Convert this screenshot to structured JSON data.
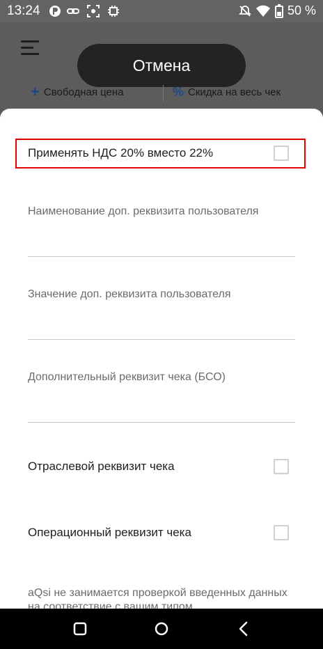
{
  "status_bar": {
    "time": "13:24",
    "battery": "50 %"
  },
  "background_app": {
    "cancel_label": "Отмена",
    "free_price_label": "Свободная цена",
    "receipt_discount_label": "Скидка на весь чек"
  },
  "sheet": {
    "vat_toggle_label": "Применять НДС 20% вместо 22%",
    "vat_toggle_checked": false,
    "user_attr_name_label": "Наименование доп. реквизита пользователя",
    "user_attr_name_value": "",
    "user_attr_value_label": "Значение доп. реквизита пользователя",
    "user_attr_value_value": "",
    "extra_receipt_attr_label": "Дополнительный реквизит чека (БСО)",
    "extra_receipt_attr_value": "",
    "industry_attr_label": "Отраслевой реквизит чека",
    "industry_attr_checked": false,
    "operational_attr_label": "Операционный реквизит чека",
    "operational_attr_checked": false,
    "note_text": "aQsi не занимается проверкой введенных данных на соответствие с вашим типом"
  },
  "colors": {
    "highlight_border": "#e00000",
    "accent_blue": "#1a4a8a"
  }
}
